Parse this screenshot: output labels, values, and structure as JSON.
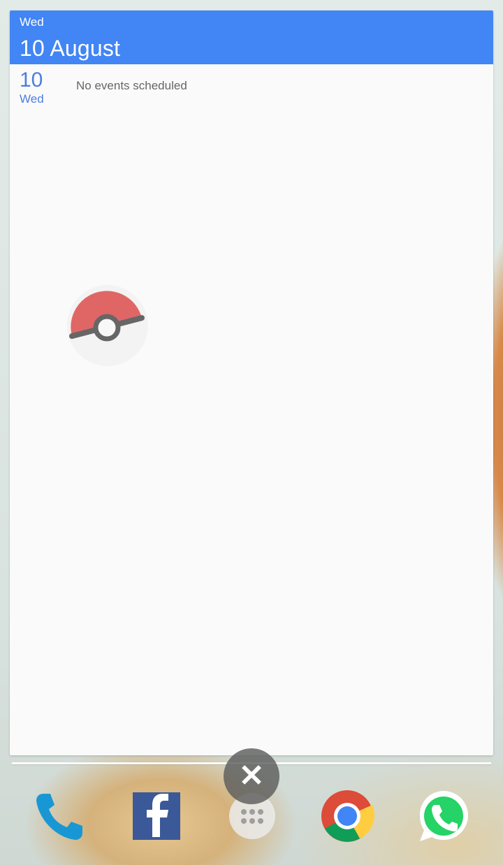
{
  "calendar": {
    "header": {
      "day": "Wed",
      "date": "10 August"
    },
    "agenda": {
      "day_number": "10",
      "day_name": "Wed",
      "empty_message": "No events scheduled"
    },
    "accent_color": "#4285f4"
  },
  "overlay": {
    "floating_icon": "pokeball-icon"
  },
  "dock": {
    "apps": [
      {
        "name": "Phone",
        "icon": "phone-icon"
      },
      {
        "name": "Facebook",
        "icon": "facebook-icon"
      },
      {
        "name": "Apps",
        "icon": "apps-icon"
      },
      {
        "name": "Chrome",
        "icon": "chrome-icon"
      },
      {
        "name": "WhatsApp",
        "icon": "whatsapp-icon"
      }
    ],
    "close_button": {
      "label": "✕",
      "icon": "close-icon"
    }
  }
}
